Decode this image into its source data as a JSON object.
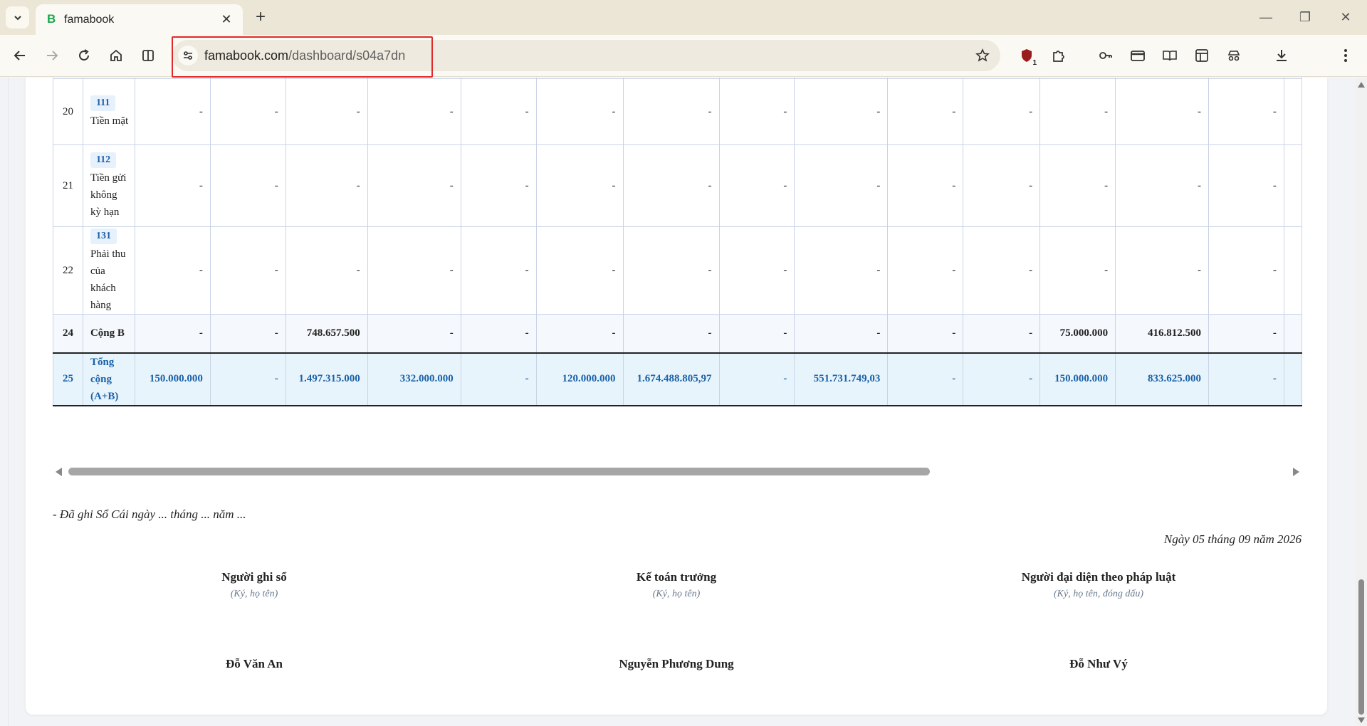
{
  "browser": {
    "tab_title": "famabook",
    "tab_favicon": "B",
    "url_host": "famabook.com",
    "url_path": "/dashboard/s04a7dn",
    "extension_badge": "1"
  },
  "ledger": {
    "rows": [
      {
        "stt": "20",
        "account_code": "111",
        "account_name": "Tiền mặt",
        "values": [
          "-",
          "-",
          "-",
          "-",
          "-",
          "-",
          "-",
          "-",
          "-",
          "-",
          "-",
          "-",
          "-",
          "-"
        ]
      },
      {
        "stt": "21",
        "account_code": "112",
        "account_name": "Tiền gửi không kỳ hạn",
        "values": [
          "-",
          "-",
          "-",
          "-",
          "-",
          "-",
          "-",
          "-",
          "-",
          "-",
          "-",
          "-",
          "-",
          "-"
        ]
      },
      {
        "stt": "22",
        "account_code": "131",
        "account_name": "Phải thu của khách hàng",
        "values": [
          "-",
          "-",
          "-",
          "-",
          "-",
          "-",
          "-",
          "-",
          "-",
          "-",
          "-",
          "-",
          "-",
          "-"
        ]
      },
      {
        "stt": "24",
        "account_name": "Cộng B",
        "values": [
          "-",
          "-",
          "748.657.500",
          "-",
          "-",
          "-",
          "-",
          "-",
          "-",
          "-",
          "-",
          "75.000.000",
          "416.812.500",
          "-"
        ]
      },
      {
        "stt": "25",
        "account_name": "Tổng cộng (A+B)",
        "values": [
          "150.000.000",
          "-",
          "1.497.315.000",
          "332.000.000",
          "-",
          "120.000.000",
          "1.674.488.805,97",
          "-",
          "551.731.749,03",
          "-",
          "-",
          "150.000.000",
          "833.625.000",
          "-"
        ]
      }
    ]
  },
  "footer": {
    "ledger_note": "- Đã ghi Sổ Cái ngày ... tháng ... năm ...",
    "date_line": "Ngày 05 tháng 09 năm 2026",
    "signatures": [
      {
        "role": "Người ghi sổ",
        "hint": "(Ký, họ tên)",
        "name": "Đỗ Văn An"
      },
      {
        "role": "Kế toán trưởng",
        "hint": "(Ký, họ tên)",
        "name": "Nguyễn Phương Dung"
      },
      {
        "role": "Người đại diện theo pháp luật",
        "hint": "(Ký, họ tên, đóng dấu)",
        "name": "Đỗ Như Vý"
      }
    ]
  }
}
